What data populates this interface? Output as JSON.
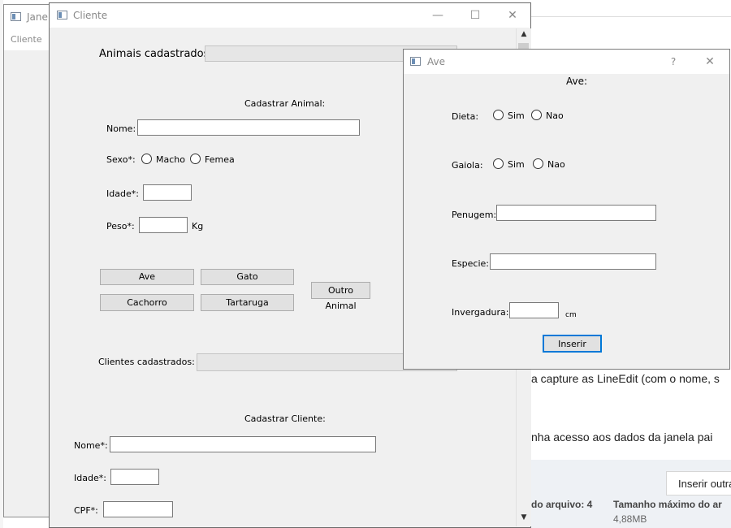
{
  "background_page": {
    "text_line1": "a capture as LineEdit (com o nome, s",
    "text_line2": "nha acesso aos dados da janela pai",
    "insert_button": "Inserir outra",
    "file_count_label": "do arquivo: 4",
    "max_size_label": "Tamanho máximo do ar",
    "max_size_value": "4,88MB"
  },
  "janela_window": {
    "title": "Janel",
    "menu": "Cliente"
  },
  "cliente_window": {
    "title": "Cliente",
    "animais_cadastrados_label": "Animais cadastrados:",
    "cadastrar_animal_header": "Cadastrar Animal:",
    "nome_label": "Nome:",
    "nome_value": "",
    "sexo_label": "Sexo*:",
    "sexo_options": [
      "Macho",
      "Femea"
    ],
    "idade_label": "Idade*:",
    "peso_label": "Peso*:",
    "peso_unit": "Kg",
    "animal_buttons": {
      "ave": "Ave",
      "gato": "Gato",
      "cachorro": "Cachorro",
      "tartaruga": "Tartaruga",
      "outro": "Outro Animal"
    },
    "clientes_cadastrados_label": "Clientes cadastrados:",
    "cadastrar_cliente_header": "Cadastrar Cliente:",
    "cliente_nome_label": "Nome*:",
    "cliente_idade_label": "Idade*:",
    "cliente_cpf_label": "CPF*:"
  },
  "ave_dialog": {
    "title": "Ave",
    "help": "?",
    "header": "Ave:",
    "dieta_label": "Dieta:",
    "dieta_options": [
      "Sim",
      "Nao"
    ],
    "gaiola_label": "Gaiola:",
    "gaiola_options": [
      "Sim",
      "Nao"
    ],
    "penugem_label": "Penugem:",
    "especie_label": "Especie:",
    "invergadura_label": "Invergadura:",
    "invergadura_unit": "cm",
    "inserir_button": "Inserir"
  }
}
